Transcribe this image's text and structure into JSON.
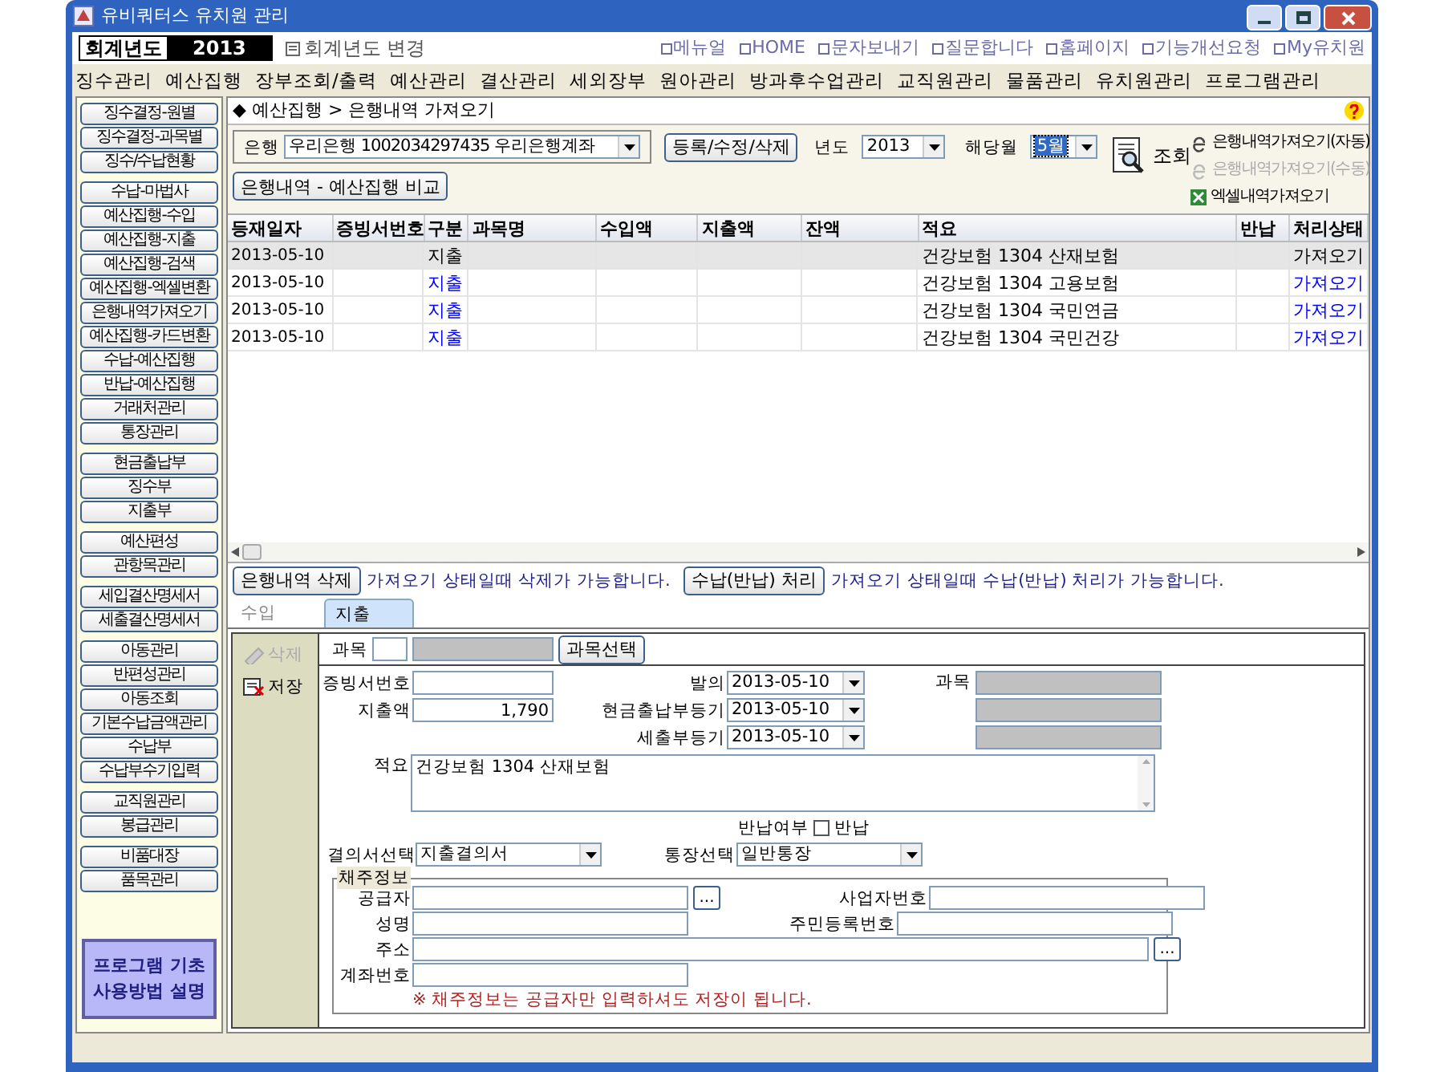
{
  "window": {
    "title": "유비쿼터스 유치원 관리"
  },
  "year_bar": {
    "label": "회계년도",
    "year": "2013",
    "change_link": "회계년도 변경"
  },
  "top_links": [
    "메뉴얼",
    "HOME",
    "문자보내기",
    "질문합니다",
    "홈페이지",
    "기능개선요청",
    "My유치원"
  ],
  "menu": [
    "징수관리",
    "예산집행",
    "장부조회/출력",
    "예산관리",
    "결산관리",
    "세외장부",
    "원아관리",
    "방과후수업관리",
    "교직원관리",
    "물품관리",
    "유치원관리",
    "프로그램관리"
  ],
  "sidebar": {
    "groups": [
      {
        "items": [
          "징수결정-원별",
          "징수결정-과목별",
          "징수/수납현황"
        ]
      },
      {
        "items": [
          "수납-마법사",
          "예산집행-수입",
          "예산집행-지출",
          "예산집행-검색",
          "예산집행-엑셀변환",
          "은행내역가져오기",
          "예산집행-카드변환",
          "수납-예산집행",
          "반납-예산집행",
          "거래처관리",
          "통장관리"
        ]
      },
      {
        "items": [
          "현금출납부",
          "징수부",
          "지출부"
        ]
      },
      {
        "items": [
          "예산편성",
          "관항목관리"
        ]
      },
      {
        "items": [
          "세입결산명세서",
          "세출결산명세서"
        ]
      },
      {
        "items": [
          "아동관리",
          "반편성관리",
          "아동조회",
          "기본수납금액관리",
          "수납부",
          "수납부수기입력"
        ]
      },
      {
        "items": [
          "교직원관리",
          "봉급관리"
        ]
      },
      {
        "items": [
          "비품대장",
          "품목관리"
        ]
      }
    ],
    "help_button": [
      "프로그램 기초",
      "사용방법 설명"
    ]
  },
  "breadcrumb": "◆ 예산집행 > 은행내역 가져오기",
  "filter": {
    "bank_label": "은행",
    "bank_value": "우리은행 1002034297435 우리은행계좌",
    "register_button": "등록/수정/삭제",
    "year_label": "년도",
    "year_value": "2013",
    "month_label": "해당월",
    "month_value": "5월",
    "query_button": "조회",
    "compare_button": "은행내역 - 예산집행 비교",
    "import_links": [
      {
        "kind": "web",
        "label": "은행내역가져오기(자동)",
        "disabled": false
      },
      {
        "kind": "web",
        "label": "은행내역가져오기(수동)",
        "disabled": true
      },
      {
        "kind": "excel",
        "label": "엑셀내역가져오기",
        "disabled": false
      }
    ]
  },
  "table": {
    "columns": [
      "등재일자",
      "증빙서번호",
      "구분",
      "과목명",
      "수입액",
      "지출액",
      "잔액",
      "적요",
      "반납",
      "처리상태"
    ],
    "rows": [
      {
        "selected": true,
        "date": "2013-05-10",
        "type": "지출",
        "summary": "건강보험 1304 산재보험",
        "status": "가져오기"
      },
      {
        "selected": false,
        "date": "2013-05-10",
        "type": "지출",
        "summary": "건강보험 1304 고용보험",
        "status": "가져오기"
      },
      {
        "selected": false,
        "date": "2013-05-10",
        "type": "지출",
        "summary": "건강보험 1304 국민연금",
        "status": "가져오기"
      },
      {
        "selected": false,
        "date": "2013-05-10",
        "type": "지출",
        "summary": "건강보험 1304 국민건강",
        "status": "가져오기"
      }
    ]
  },
  "actions": [
    {
      "button": "은행내역 삭제",
      "note": "가져오기 상태일때 삭제가 가능합니다."
    },
    {
      "button": "수납(반납) 처리",
      "note": "가져오기 상태일때 수납(반납) 처리가 가능합니다."
    }
  ],
  "tabs": [
    {
      "label": "수입",
      "selected": false
    },
    {
      "label": "지출",
      "selected": true
    }
  ],
  "form": {
    "side_buttons": [
      {
        "kind": "delete",
        "label": "삭제",
        "disabled": true
      },
      {
        "kind": "save",
        "label": "저장",
        "disabled": false
      }
    ],
    "subject_label": "과목",
    "subject_button": "과목선택",
    "left_fields": [
      {
        "label": "증빙서번호"
      },
      {
        "label": "지출액",
        "value": "1,790"
      }
    ],
    "date_fields": [
      {
        "label": "발의",
        "value": "2013-05-10"
      },
      {
        "label": "현금출납부등기",
        "value": "2013-05-10"
      },
      {
        "label": "세출부등기",
        "value": "2013-05-10"
      }
    ],
    "right_label": "과목",
    "summary_label": "적요",
    "summary_value": "건강보험 1304 산재보험",
    "refund": {
      "label": "반납여부",
      "checkbox_label": "반납",
      "checked": false
    },
    "resolution": {
      "label": "결의서선택",
      "value": "지출결의서"
    },
    "account": {
      "label": "통장선택",
      "value": "일반통장"
    },
    "creditor": {
      "legend": "채주정보",
      "rows": [
        [
          {
            "label": "공급자",
            "lookup": "..."
          },
          {
            "label": "사업자번호"
          }
        ],
        [
          {
            "label": "성명"
          },
          {
            "label": "주민등록번호"
          }
        ],
        [
          {
            "label": "주소",
            "lookup": "..."
          }
        ],
        [
          {
            "label": "계좌번호"
          }
        ]
      ],
      "note": "※ 채주정보는 공급자만 입력하셔도 저장이 됩니다."
    }
  }
}
